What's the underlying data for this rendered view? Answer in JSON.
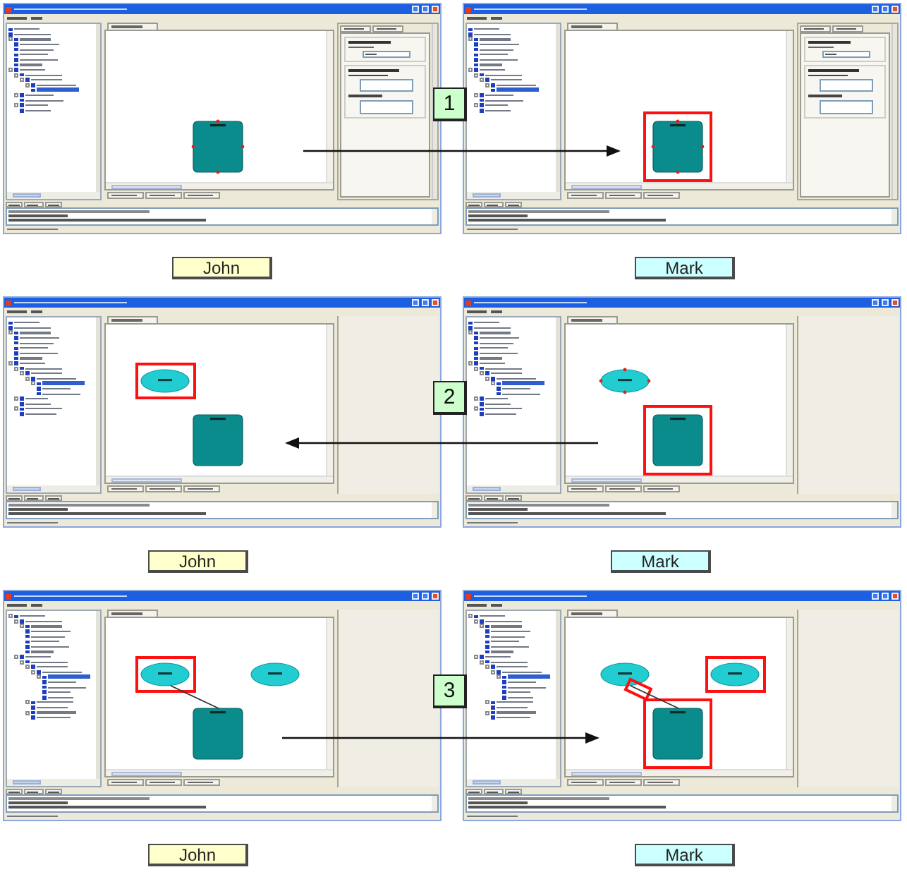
{
  "steps": [
    {
      "number": "1",
      "arrow_points_left": false,
      "panels": [
        {
          "screen": {
            "properties_panel": true,
            "tree": [
              {
                "selected": false
              },
              {
                "selected": false
              },
              {
                "selected": false,
                "children": [
                  {
                    "selected": false
                  },
                  {
                    "selected": false
                  },
                  {
                    "selected": false
                  },
                  {
                    "selected": false
                  },
                  {
                    "selected": false
                  }
                ]
              },
              {
                "selected": false,
                "children": [
                  {
                    "selected": false,
                    "children": [
                      {
                        "selected": false,
                        "children": [
                          {
                            "selected": false,
                            "children": [
                              {
                                "selected": true
                              }
                            ]
                          }
                        ]
                      }
                    ]
                  },
                  {
                    "selected": false,
                    "children": [
                      {
                        "selected": false
                      }
                    ]
                  },
                  {
                    "selected": false,
                    "children": [
                      {
                        "selected": false
                      }
                    ]
                  }
                ]
              }
            ],
            "shapes": [
              {
                "kind": "rectangle",
                "selected": true,
                "highlighted": false
              }
            ]
          },
          "user": {
            "name": "John",
            "color": "#ffffcc"
          }
        },
        {
          "screen": {
            "properties_panel": true,
            "tree": [
              {
                "selected": false
              },
              {
                "selected": false
              },
              {
                "selected": false,
                "children": [
                  {
                    "selected": false
                  },
                  {
                    "selected": false
                  },
                  {
                    "selected": false
                  },
                  {
                    "selected": false
                  },
                  {
                    "selected": false
                  }
                ]
              },
              {
                "selected": false,
                "children": [
                  {
                    "selected": false,
                    "children": [
                      {
                        "selected": false,
                        "children": [
                          {
                            "selected": false,
                            "children": [
                              {
                                "selected": true
                              }
                            ]
                          }
                        ]
                      }
                    ]
                  },
                  {
                    "selected": false,
                    "children": [
                      {
                        "selected": false
                      }
                    ]
                  },
                  {
                    "selected": false,
                    "children": [
                      {
                        "selected": false
                      }
                    ]
                  }
                ]
              }
            ],
            "shapes": [
              {
                "kind": "rectangle",
                "selected": true,
                "highlighted": true
              }
            ]
          },
          "user": {
            "name": "Mark",
            "color": "#ccffff"
          }
        }
      ]
    },
    {
      "number": "2",
      "arrow_points_left": true,
      "panels": [
        {
          "screen": {
            "properties_panel": false,
            "tree": [
              {
                "selected": false
              },
              {
                "selected": false
              },
              {
                "selected": false,
                "children": [
                  {
                    "selected": false
                  },
                  {
                    "selected": false
                  },
                  {
                    "selected": false
                  },
                  {
                    "selected": false
                  },
                  {
                    "selected": false
                  }
                ]
              },
              {
                "selected": false,
                "children": [
                  {
                    "selected": false,
                    "children": [
                      {
                        "selected": false,
                        "children": [
                          {
                            "selected": false,
                            "children": [
                              {
                                "selected": true,
                                "children": [
                                  {
                                    "selected": false
                                  },
                                  {
                                    "selected": false
                                  }
                                ]
                              }
                            ]
                          }
                        ]
                      }
                    ]
                  },
                  {
                    "selected": false,
                    "children": [
                      {
                        "selected": false
                      }
                    ]
                  },
                  {
                    "selected": false,
                    "children": [
                      {
                        "selected": false
                      }
                    ]
                  }
                ]
              }
            ],
            "shapes": [
              {
                "kind": "ellipse",
                "selected": false,
                "highlighted": true
              },
              {
                "kind": "rectangle",
                "selected": false,
                "highlighted": false
              }
            ]
          },
          "user": {
            "name": "John",
            "color": "#ffffcc"
          }
        },
        {
          "screen": {
            "properties_panel": false,
            "tree": [
              {
                "selected": false
              },
              {
                "selected": false
              },
              {
                "selected": false,
                "children": [
                  {
                    "selected": false
                  },
                  {
                    "selected": false
                  },
                  {
                    "selected": false
                  },
                  {
                    "selected": false
                  },
                  {
                    "selected": false
                  }
                ]
              },
              {
                "selected": false,
                "children": [
                  {
                    "selected": false,
                    "children": [
                      {
                        "selected": false,
                        "children": [
                          {
                            "selected": false,
                            "children": [
                              {
                                "selected": true,
                                "children": [
                                  {
                                    "selected": false
                                  },
                                  {
                                    "selected": false
                                  }
                                ]
                              }
                            ]
                          }
                        ]
                      }
                    ]
                  },
                  {
                    "selected": false,
                    "children": [
                      {
                        "selected": false
                      }
                    ]
                  },
                  {
                    "selected": false,
                    "children": [
                      {
                        "selected": false
                      }
                    ]
                  }
                ]
              }
            ],
            "shapes": [
              {
                "kind": "ellipse",
                "selected": true,
                "highlighted": false
              },
              {
                "kind": "rectangle",
                "selected": false,
                "highlighted": true
              }
            ]
          },
          "user": {
            "name": "Mark",
            "color": "#ccffff"
          }
        }
      ]
    },
    {
      "number": "3",
      "arrow_points_left": false,
      "panels": [
        {
          "screen": {
            "properties_panel": false,
            "tree": [
              {
                "selected": false,
                "children": [
                  {
                    "selected": false,
                    "children": [
                      {
                        "selected": false,
                        "children": [
                          {
                            "selected": false
                          },
                          {
                            "selected": false
                          },
                          {
                            "selected": false
                          },
                          {
                            "selected": false
                          },
                          {
                            "selected": false
                          }
                        ]
                      }
                    ]
                  },
                  {
                    "selected": false,
                    "children": [
                      {
                        "selected": false,
                        "children": [
                          {
                            "selected": false,
                            "children": [
                              {
                                "selected": false,
                                "children": [
                                  {
                                    "selected": true,
                                    "children": [
                                      {
                                        "selected": false
                                      },
                                      {
                                        "selected": false
                                      },
                                      {
                                        "selected": false
                                      },
                                      {
                                        "selected": false
                                      }
                                    ]
                                  }
                                ]
                              }
                            ]
                          },
                          {
                            "selected": false,
                            "children": [
                              {
                                "selected": false
                              }
                            ]
                          },
                          {
                            "selected": false,
                            "children": [
                              {
                                "selected": false
                              }
                            ]
                          }
                        ]
                      }
                    ]
                  }
                ]
              }
            ],
            "shapes": [
              {
                "kind": "ellipse",
                "selected": false,
                "highlighted": true
              },
              {
                "kind": "ellipse",
                "selected": false,
                "highlighted": false
              },
              {
                "kind": "connector",
                "selected": false,
                "highlighted": false
              },
              {
                "kind": "rectangle",
                "selected": false,
                "highlighted": false
              }
            ]
          },
          "user": {
            "name": "John",
            "color": "#ffffcc"
          }
        },
        {
          "screen": {
            "properties_panel": false,
            "tree": [
              {
                "selected": false,
                "children": [
                  {
                    "selected": false,
                    "children": [
                      {
                        "selected": false,
                        "children": [
                          {
                            "selected": false
                          },
                          {
                            "selected": false
                          },
                          {
                            "selected": false
                          },
                          {
                            "selected": false
                          },
                          {
                            "selected": false
                          }
                        ]
                      }
                    ]
                  },
                  {
                    "selected": false,
                    "children": [
                      {
                        "selected": false,
                        "children": [
                          {
                            "selected": false,
                            "children": [
                              {
                                "selected": false,
                                "children": [
                                  {
                                    "selected": true,
                                    "children": [
                                      {
                                        "selected": false
                                      },
                                      {
                                        "selected": false
                                      },
                                      {
                                        "selected": false
                                      },
                                      {
                                        "selected": false
                                      }
                                    ]
                                  }
                                ]
                              }
                            ]
                          },
                          {
                            "selected": false,
                            "children": [
                              {
                                "selected": false
                              }
                            ]
                          },
                          {
                            "selected": false,
                            "children": [
                              {
                                "selected": false
                              }
                            ]
                          }
                        ]
                      }
                    ]
                  }
                ]
              }
            ],
            "shapes": [
              {
                "kind": "ellipse",
                "selected": false,
                "highlighted": false
              },
              {
                "kind": "ellipse",
                "selected": false,
                "highlighted": true
              },
              {
                "kind": "connector",
                "selected": false,
                "highlighted": true
              },
              {
                "kind": "rectangle",
                "selected": false,
                "highlighted": true
              }
            ]
          },
          "user": {
            "name": "Mark",
            "color": "#ccffff"
          }
        }
      ]
    }
  ]
}
